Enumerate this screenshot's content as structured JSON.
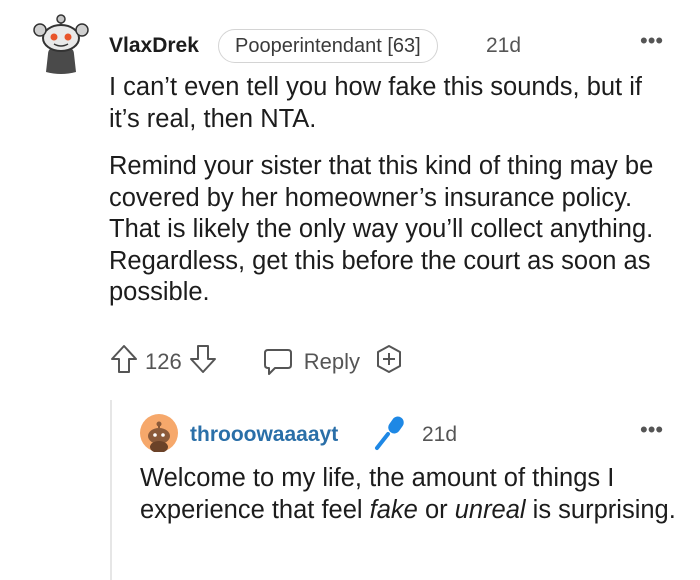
{
  "comment": {
    "username": "VlaxDrek",
    "flair": "Pooperintendant [63]",
    "time": "21d",
    "more": "•••",
    "paragraph1": "I can’t even tell you how fake this sounds, but if it’s real, then NTA.",
    "paragraph2": "Remind your sister that this kind of thing may be covered by her homeowner’s insurance policy. That is likely the only way you’ll collect anything. Regardless, get this before the court as soon as possible.",
    "votes": "126",
    "reply_label": "Reply"
  },
  "reply_comment": {
    "username": "throoowaaaayt",
    "time": "21d",
    "more": "•••",
    "text_part1": "Welcome to my life, the amount of things I experience that feel ",
    "text_italic1": "fake",
    "text_part2": " or ",
    "text_italic2": "unreal",
    "text_part3": " is surprising."
  },
  "icons": [
    "snoo-avatar-icon",
    "upvote-icon",
    "downvote-icon",
    "chat-bubble-icon",
    "add-award-icon",
    "snoo-avatar-orange-icon",
    "microphone-icon"
  ],
  "colors": {
    "username_reply": "#2a6fa8",
    "avatar_orange": "#f6a86b",
    "mic_blue": "#1e88e5"
  }
}
